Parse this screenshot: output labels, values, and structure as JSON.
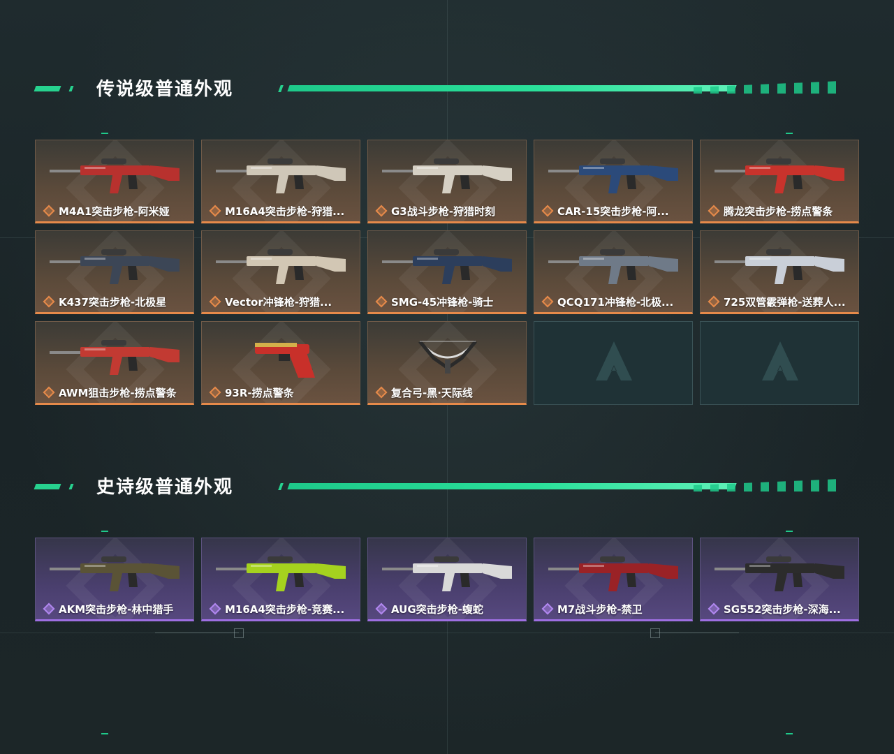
{
  "sections": {
    "legendary": {
      "title": "传说级普通外观",
      "items": [
        {
          "label": "M4A1突击步枪-阿米娅",
          "color": "#b8312e"
        },
        {
          "label": "M16A4突击步枪-狩猎...",
          "color": "#cfc7b8"
        },
        {
          "label": "G3战斗步枪-狩猎时刻",
          "color": "#d6d0c4"
        },
        {
          "label": "CAR-15突击步枪-阿...",
          "color": "#2b4a7a"
        },
        {
          "label": "腾龙突击步枪-捞点警条",
          "color": "#c8332c"
        },
        {
          "label": "K437突击步枪-北极星",
          "color": "#3c4656"
        },
        {
          "label": "Vector冲锋枪-狩猎...",
          "color": "#d2c7b4"
        },
        {
          "label": "SMG-45冲锋枪-骑士",
          "color": "#2c3e5c"
        },
        {
          "label": "QCQ171冲锋枪-北极...",
          "color": "#6f7a88"
        },
        {
          "label": "725双管霰弹枪-送葬人...",
          "color": "#c9cfd8"
        },
        {
          "label": "AWM狙击步枪-捞点警条",
          "color": "#c23a32"
        },
        {
          "label": "93R-捞点警条",
          "color": "#c8302a"
        },
        {
          "label": "复合弓-黑·天际线",
          "color": "#2a2a2a"
        }
      ],
      "empty_slots": 2
    },
    "epic": {
      "title": "史诗级普通外观",
      "items": [
        {
          "label": "AKM突击步枪-林中猎手",
          "color": "#5a5336"
        },
        {
          "label": "M16A4突击步枪-竞赛...",
          "color": "#a5d21e"
        },
        {
          "label": "AUG突击步枪-蝮蛇",
          "color": "#d9d9d9"
        },
        {
          "label": "M7战斗步枪-禁卫",
          "color": "#9a2226"
        },
        {
          "label": "SG552突击步枪-深海...",
          "color": "#2c2c2c"
        }
      ]
    }
  },
  "colors": {
    "accent_green": "#27d28f",
    "legendary_orange": "#e68a4a",
    "epic_purple": "#9e6fe2"
  }
}
